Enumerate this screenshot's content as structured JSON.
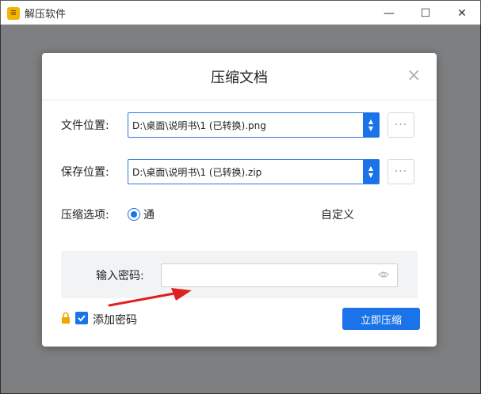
{
  "app": {
    "title": "解压软件",
    "icon": "app-icon"
  },
  "window_controls": {
    "minimize": "—",
    "maximize": "☐",
    "close": "✕"
  },
  "dialog": {
    "title": "压缩文档",
    "close_symbol": "×",
    "file_location": {
      "label": "文件位置:",
      "value": "D:\\桌面\\说明书\\1 (已转换).png"
    },
    "save_location": {
      "label": "保存位置:",
      "value": "D:\\桌面\\说明书\\1 (已转换).zip"
    },
    "compress_options": {
      "label": "压缩选项:",
      "selected_text": "通",
      "trailing_text": "自定义"
    },
    "more_label": "···",
    "password": {
      "label": "输入密码:",
      "value": "",
      "placeholder": ""
    },
    "add_password": {
      "label": "添加密码",
      "checked": true
    },
    "compress_button": "立即压缩"
  },
  "colors": {
    "accent": "#1a73e8",
    "app_icon": "#f5b400",
    "arrow": "#e02020"
  }
}
